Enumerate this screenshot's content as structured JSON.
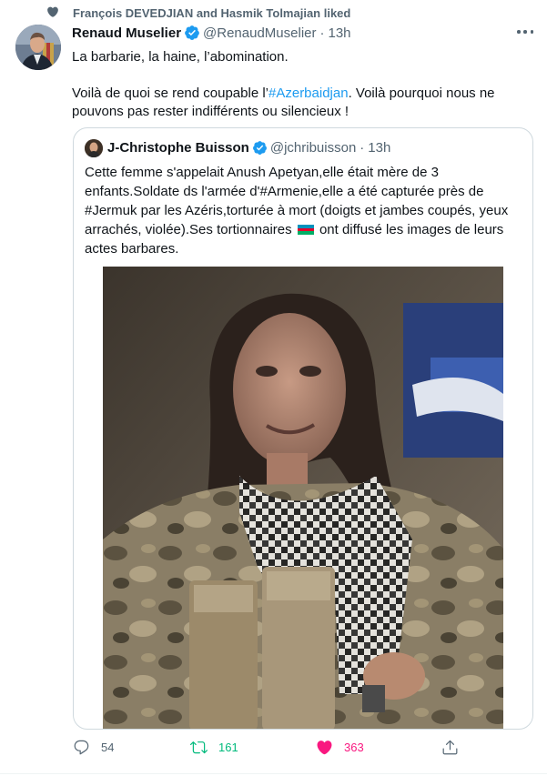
{
  "social_context": {
    "text": "François DEVEDJIAN and Hasmik Tolmajian liked",
    "icon": "heart-icon"
  },
  "tweet": {
    "author_name": "Renaud Muselier",
    "handle": "@RenaudMuselier",
    "separator": "·",
    "time": "13h",
    "text_line1": "La barbarie, la haine, l’abomination.",
    "text_line2_prefix": "Voilà de quoi se rend coupable l’",
    "hashtag": "#Azerbaidjan",
    "text_line2_suffix": ". Voilà pourquoi nous ne pouvons pas rester indifférents ou silencieux !"
  },
  "quoted_tweet": {
    "author_name": "J-Christophe Buisson",
    "handle": "@jchribuisson",
    "separator": "·",
    "time": "13h",
    "text_before_flag": "Cette femme s'appelait Anush Apetyan,elle était mère de 3 enfants.Soldate ds l'armée d'#Armenie,elle a été capturée près de #Jermuk par les Azéris,torturée à mort (doigts et jambes coupés, yeux arrachés, violée).Ses tortionnaires ",
    "flag_icon": "azerbaijan-flag-icon",
    "text_after_flag": " ont diffusé les images de leurs actes barbares."
  },
  "actions": {
    "reply_count": "54",
    "retweet_count": "161",
    "like_count": "363"
  },
  "colors": {
    "accent": "#1d9bf0",
    "retweet_green": "#00ba7c",
    "like_pink": "#f91880",
    "secondary_text": "#536471",
    "border": "#cfd9de"
  }
}
